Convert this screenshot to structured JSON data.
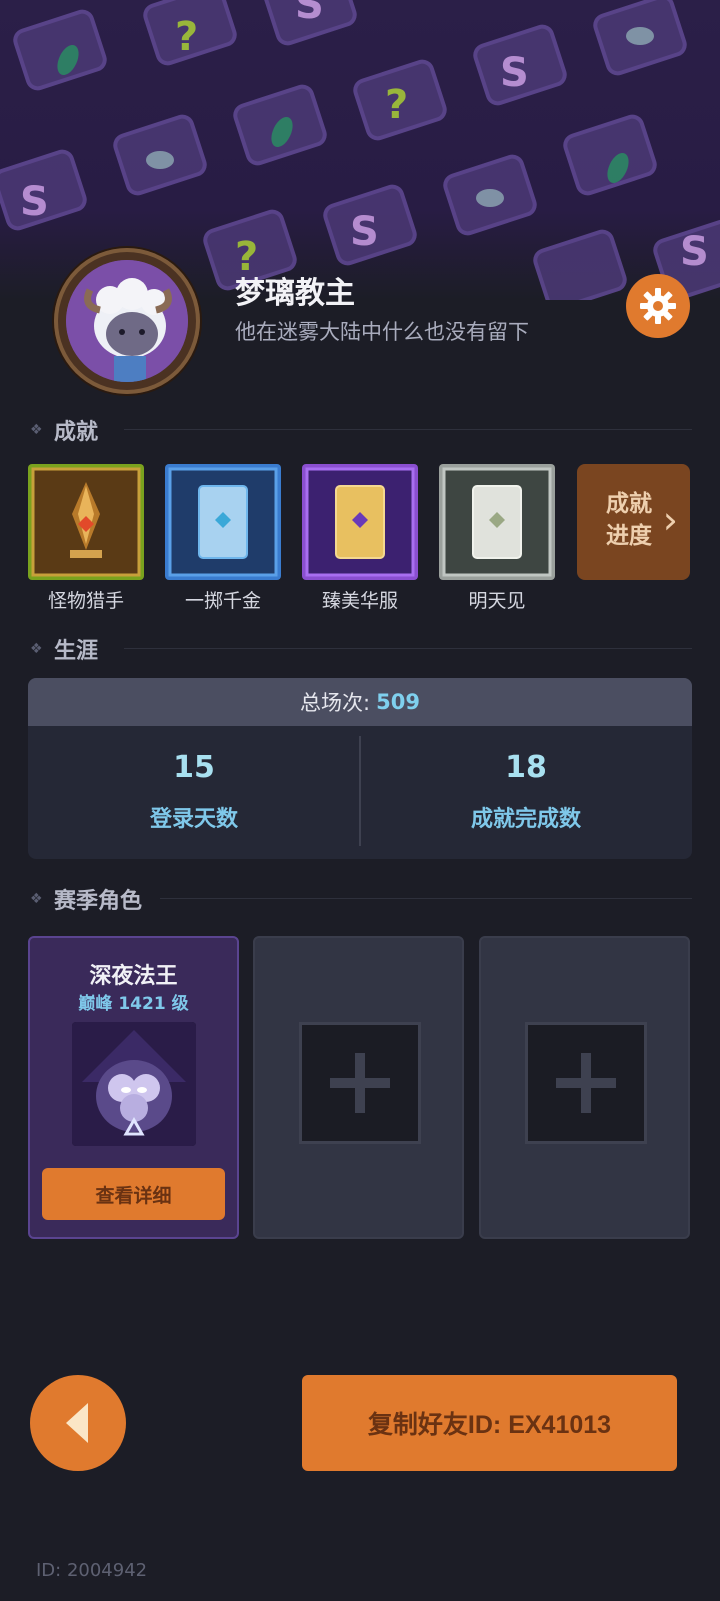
{
  "profile": {
    "name": "梦璃教主",
    "motto": "他在迷雾大陆中什么也没有留下"
  },
  "sections": {
    "achievements": "成就",
    "career": "生涯",
    "season_roles": "赛季角色"
  },
  "achievements": [
    {
      "label": "怪物猎手",
      "icon": "monster-hunter-badge",
      "frame_color": "#7aa21e"
    },
    {
      "label": "一掷千金",
      "icon": "card-badge-blue",
      "frame_color": "#3a7ccf"
    },
    {
      "label": "臻美华服",
      "icon": "card-badge-purple",
      "frame_color": "#8a4fd0"
    },
    {
      "label": "明天见",
      "icon": "card-badge-silver",
      "frame_color": "#9aa09c"
    }
  ],
  "achievement_progress": {
    "label_line1": "成就",
    "label_line2": "进度",
    "chevron": "›"
  },
  "career": {
    "total_label": "总场次:",
    "total_value": "509",
    "stats": [
      {
        "value": "15",
        "label": "登录天数"
      },
      {
        "value": "18",
        "label": "成就完成数"
      }
    ]
  },
  "season_roles": {
    "filled": {
      "name": "深夜法王",
      "rank": "巅峰 1421 级",
      "button": "查看详细"
    },
    "empty_slots": 2
  },
  "footer": {
    "copy_button": "复制好友ID: EX41013",
    "player_id": "ID: 2004942"
  },
  "colors": {
    "accent": "#e07a2e",
    "highlight": "#7fd0ee",
    "background": "#1c1d26"
  }
}
